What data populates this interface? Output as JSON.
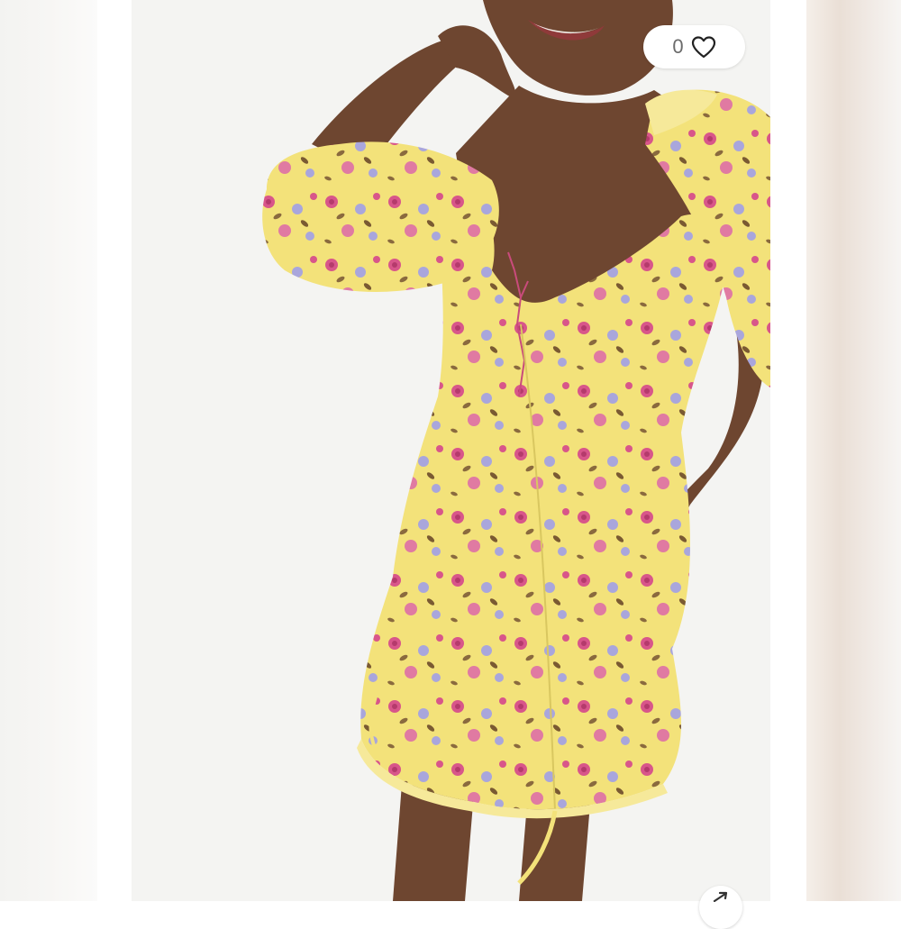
{
  "listing": {
    "photo_alt": "",
    "like_count": "0",
    "like_icon": "heart-outline-icon",
    "share_icon": "share-arrow-icon"
  },
  "colors": {
    "dress": "#f3e27a",
    "rose": "#d8568a",
    "lavender": "#a9a6dc",
    "leaf": "#8a6a3e",
    "skin": "#6e4630",
    "backdrop": "#f4f4f2"
  }
}
